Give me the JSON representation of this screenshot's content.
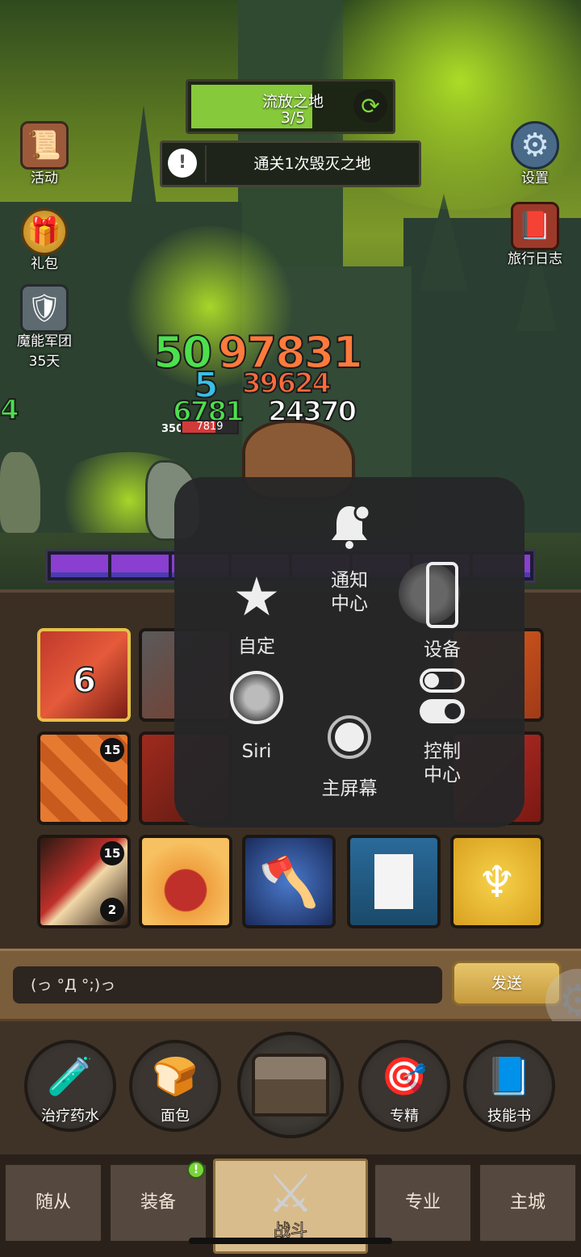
{
  "hud": {
    "stage_name": "流放之地",
    "stage_progress": "3/5",
    "quest_text": "通关1次毁灭之地",
    "refresh_icon": "refresh-icon",
    "info_icon": "exclamation-icon"
  },
  "left_menu": {
    "activity": "活动",
    "gift": "礼包",
    "legion": "魔能军团",
    "legion_days": "35天"
  },
  "right_menu": {
    "settings": "设置",
    "journal": "旅行日志"
  },
  "damage": {
    "d1": "50",
    "d2": "97831",
    "d3": "5",
    "d4": "39624",
    "d5": "6781",
    "d6": "24370",
    "d7": "4",
    "hp_number": "350",
    "hp_current": "7819"
  },
  "skills": {
    "level_6": "6",
    "badge_15a": "15",
    "badge_15b": "15",
    "badge_2": "2"
  },
  "chat": {
    "message": "(っ °Д °;)っ",
    "send_label": "发送"
  },
  "quick": {
    "potion": "治疗药水",
    "bread": "面包",
    "elite": "专精",
    "skill_book": "技能书"
  },
  "nav": {
    "followers": "随从",
    "equipment": "装备",
    "battle": "战斗",
    "profession": "专业",
    "main_city": "主城",
    "notification": "!"
  },
  "assistive": {
    "notification_center": "通知\n中心",
    "custom": "自定",
    "device": "设备",
    "siri": "Siri",
    "control_center": "控制\n中心",
    "home_screen": "主屏幕"
  },
  "colors": {
    "hp_red": "#d23a3a",
    "boss_purple": "#8a3fd0",
    "stage_green": "#86c93a",
    "send_gold": "#e0b860"
  }
}
